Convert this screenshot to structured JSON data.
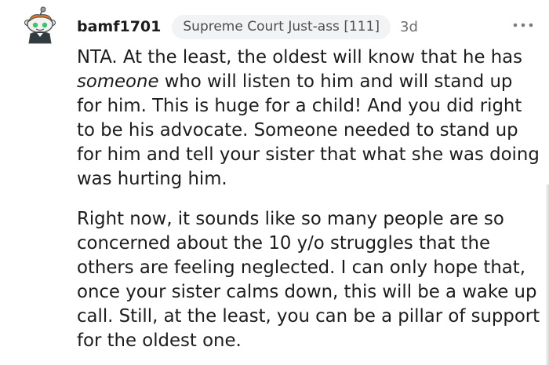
{
  "comment": {
    "username": "bamf1701",
    "flair": "Supreme Court Just-ass [111]",
    "age": "3d",
    "avatar_icon": "snoo-avatar-icon",
    "more_icon": "more-options-icon",
    "paragraph1": {
      "before": "NTA. At the least, the oldest will know that he has ",
      "emphasis": "someone",
      "after": " who will listen to him and will stand up for him. This is huge for a child! And you did right to be his advocate. Someone needed to stand up for him and tell your sister that what she was doing was hurting him."
    },
    "paragraph2": "Right now, it sounds like so many people are so concerned about the 10 y/o struggles that the others are feeling neglected. I can only hope that, once your sister calms down, this will be a wake up call. Still, at the least, you can be a pillar of support for the oldest one."
  },
  "colors": {
    "text": "#1c1c1c",
    "flair_background": "#f1f3f4",
    "meta_text": "#6c6f72"
  }
}
